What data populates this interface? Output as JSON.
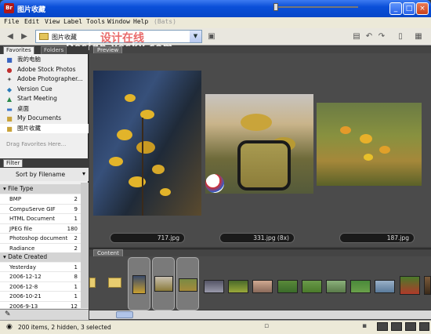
{
  "window": {
    "title": "图片收藏",
    "app_icon_label": "Br",
    "minimize": "_",
    "maximize": "□",
    "close": "×"
  },
  "menu": [
    "File",
    "Edit",
    "View",
    "Label",
    "Tools",
    "Window",
    "Help",
    "(Bats)"
  ],
  "toolbar": {
    "path": "图片收藏"
  },
  "watermark": {
    "cn": "设计在线",
    "en": "Design.yesky.com"
  },
  "left_panel": {
    "tabs": [
      "Favorites",
      "Folders"
    ],
    "favorites": [
      {
        "label": "我的电脑",
        "icon": "computer-icon"
      },
      {
        "label": "Adobe Stock Photos",
        "icon": "stock-photos-icon"
      },
      {
        "label": "Adobe Photographer...",
        "icon": "photographer-icon"
      },
      {
        "label": "Version Cue",
        "icon": "version-cue-icon"
      },
      {
        "label": "Start Meeting",
        "icon": "meeting-icon"
      },
      {
        "label": "桌面",
        "icon": "desktop-icon"
      },
      {
        "label": "My Documents",
        "icon": "folder-icon"
      },
      {
        "label": "图片收藏",
        "icon": "folder-icon"
      }
    ],
    "drag_hint": "Drag Favorites Here...",
    "filter_tab": "Filter",
    "sort_label": "Sort by Filename",
    "groups": [
      {
        "title": "File Type",
        "rows": [
          {
            "label": "BMP",
            "count": "2"
          },
          {
            "label": "CompuServe GIF",
            "count": "9"
          },
          {
            "label": "HTML Document",
            "count": "1"
          },
          {
            "label": "JPEG file",
            "count": "180"
          },
          {
            "label": "Photoshop document",
            "count": "2"
          },
          {
            "label": "Radiance",
            "count": "2"
          }
        ]
      },
      {
        "title": "Date Created",
        "rows": [
          {
            "label": "Yesterday",
            "count": "1"
          },
          {
            "label": "2006-12-12",
            "count": "8"
          },
          {
            "label": "2006-12-8",
            "count": "1"
          },
          {
            "label": "2006-10-21",
            "count": "1"
          },
          {
            "label": "2006-9-13",
            "count": "12"
          }
        ]
      }
    ]
  },
  "preview": {
    "tab": "Preview",
    "captions": [
      "717.jpg",
      "331.jpg (8x)",
      "187.jpg"
    ]
  },
  "content": {
    "tab": "Content"
  },
  "status": {
    "text": "200 items, 2 hidden, 3 selected"
  }
}
